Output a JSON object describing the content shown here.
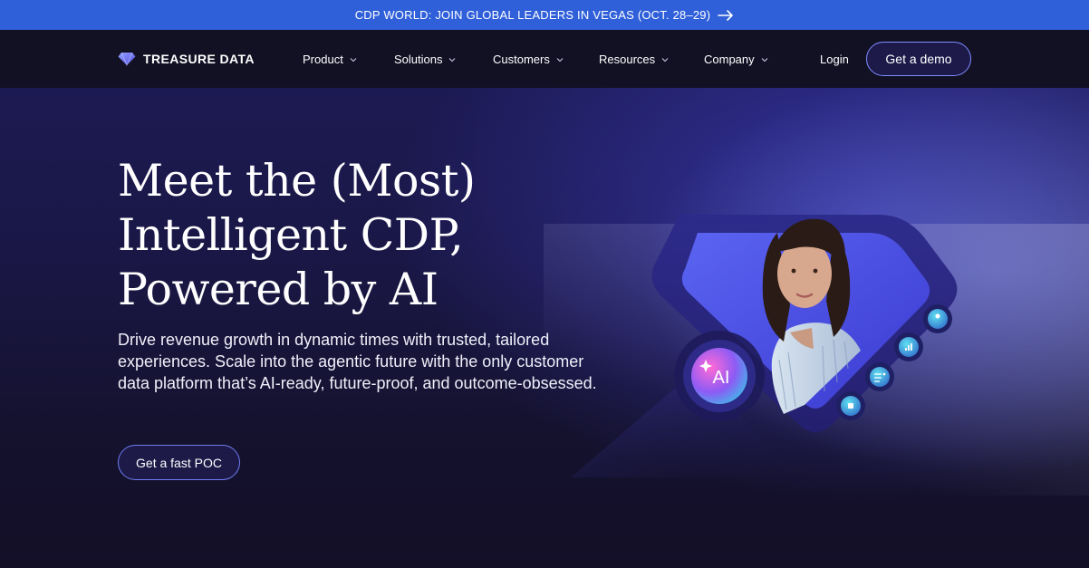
{
  "announcement": {
    "text": "CDP WORLD: JOIN GLOBAL LEADERS IN VEGAS (OCT. 28–29)",
    "icon": "arrow-right-icon"
  },
  "brand": {
    "name": "TREASURE DATA",
    "logo_icon": "diamond-logo-icon"
  },
  "nav": {
    "items": [
      {
        "label": "Product"
      },
      {
        "label": "Solutions"
      },
      {
        "label": "Customers"
      },
      {
        "label": "Resources"
      },
      {
        "label": "Company"
      }
    ],
    "login_label": "Login",
    "demo_label": "Get a demo"
  },
  "hero": {
    "headline": "Meet the (Most) Intelligent CDP, Powered by AI",
    "subtext": "Drive revenue growth in dynamic times with trusted, tailored experiences. Scale into the agentic future with the only customer data platform that’s AI-ready, future-proof, and outcome-obsessed.",
    "cta_label": "Get a fast POC",
    "ai_badge": "AI"
  },
  "colors": {
    "announcement_bg": "#2f5fd9",
    "nav_bg": "#121124",
    "accent": "#6f7bf0"
  }
}
